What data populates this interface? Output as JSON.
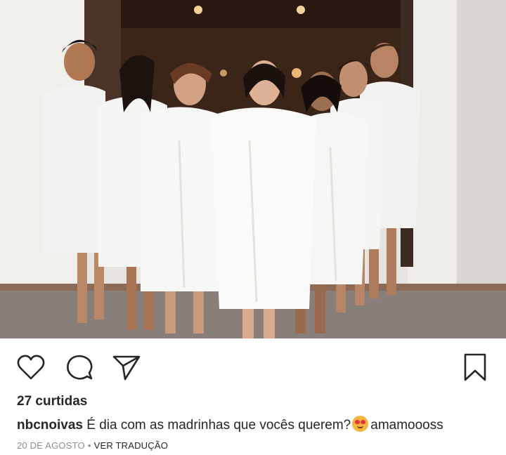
{
  "post": {
    "likes_text": "27 curtidas",
    "username": "nbcnoivas",
    "caption_text": "É dia com as madrinhas que vocês querem?",
    "caption_emoji": "smiling-face-with-heart-eyes",
    "caption_suffix": "amamoooss",
    "date": "20 DE AGOSTO",
    "separator": "•",
    "translate_label": "VER TRADUÇÃO"
  },
  "icons": {
    "like": "heart-outline-icon",
    "comment": "comment-bubble-icon",
    "share": "paper-plane-icon",
    "save": "bookmark-outline-icon"
  },
  "colors": {
    "text": "#262626",
    "muted": "#8e8e8e",
    "background": "#ffffff"
  }
}
